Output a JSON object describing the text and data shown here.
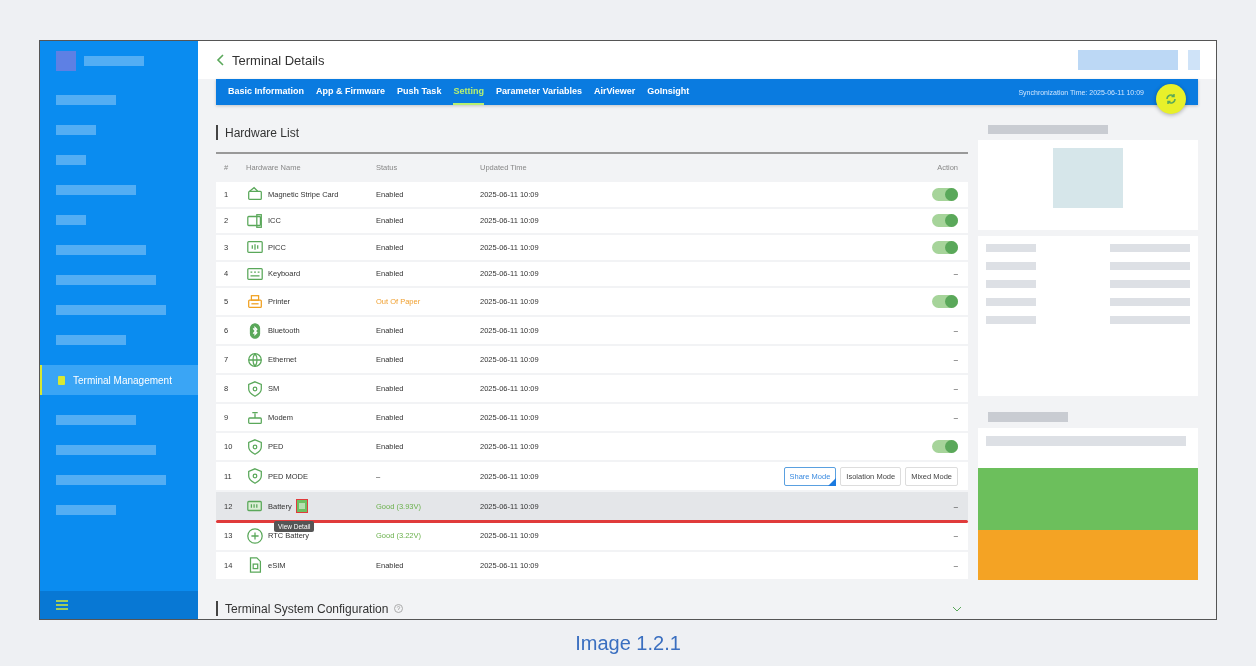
{
  "sidebar": {
    "items": [
      {
        "label": "Terminal Management",
        "selected": true
      }
    ]
  },
  "header": {
    "title": "Terminal Details"
  },
  "tabs": [
    {
      "label": "Basic Information",
      "selected": false
    },
    {
      "label": "App & Firmware",
      "selected": false
    },
    {
      "label": "Push Task",
      "selected": false
    },
    {
      "label": "Setting",
      "selected": true
    },
    {
      "label": "Parameter Variables",
      "selected": false
    },
    {
      "label": "AirViewer",
      "selected": false
    },
    {
      "label": "GoInsight",
      "selected": false
    }
  ],
  "sync_time": "Synchronization Time: 2025-06-11 10:09",
  "hardware_list": {
    "title": "Hardware List",
    "columns": [
      "#",
      "Hardware Name",
      "Status",
      "Updated Time",
      "Action"
    ],
    "rows": [
      {
        "index": "1",
        "kind": "card",
        "name": "Magnetic Stripe Card",
        "status": {
          "text": "Enabled",
          "kind": "normal"
        },
        "time": "2025-06-11 10:09",
        "highlighted": false,
        "action": {
          "kind": "toggle",
          "on": true
        }
      },
      {
        "index": "2",
        "kind": "chip",
        "name": "ICC",
        "status": {
          "text": "Enabled",
          "kind": "normal"
        },
        "time": "2025-06-11 10:09",
        "highlighted": false,
        "action": {
          "kind": "toggle",
          "on": true
        }
      },
      {
        "index": "3",
        "kind": "contactless",
        "name": "PICC",
        "status": {
          "text": "Enabled",
          "kind": "normal"
        },
        "time": "2025-06-11 10:09",
        "highlighted": false,
        "action": {
          "kind": "toggle",
          "on": true
        }
      },
      {
        "index": "4",
        "kind": "keyboard",
        "name": "Keyboard",
        "status": {
          "text": "Enabled",
          "kind": "normal"
        },
        "time": "2025-06-11 10:09",
        "highlighted": false,
        "action": {
          "kind": "text",
          "text": "–"
        }
      },
      {
        "index": "5",
        "kind": "printer",
        "name": "Printer",
        "status": {
          "text": "Out Of Paper",
          "kind": "warning"
        },
        "time": "2025-06-11 10:09",
        "highlighted": false,
        "action": {
          "kind": "toggle",
          "on": true
        }
      },
      {
        "index": "6",
        "kind": "bluetooth",
        "name": "Bluetooth",
        "status": {
          "text": "Enabled",
          "kind": "normal"
        },
        "time": "2025-06-11 10:09",
        "highlighted": false,
        "action": {
          "kind": "text",
          "text": "–"
        }
      },
      {
        "index": "7",
        "kind": "globe",
        "name": "Ethernet",
        "status": {
          "text": "Enabled",
          "kind": "normal"
        },
        "time": "2025-06-11 10:09",
        "highlighted": false,
        "action": {
          "kind": "text",
          "text": "–"
        }
      },
      {
        "index": "8",
        "kind": "shield",
        "name": "SM",
        "status": {
          "text": "Enabled",
          "kind": "normal"
        },
        "time": "2025-06-11 10:09",
        "highlighted": false,
        "action": {
          "kind": "text",
          "text": "–"
        }
      },
      {
        "index": "9",
        "kind": "modem",
        "name": "Modem",
        "status": {
          "text": "Enabled",
          "kind": "normal"
        },
        "time": "2025-06-11 10:09",
        "highlighted": false,
        "action": {
          "kind": "text",
          "text": "–"
        }
      },
      {
        "index": "10",
        "kind": "shield",
        "name": "PED",
        "status": {
          "text": "Enabled",
          "kind": "normal"
        },
        "time": "2025-06-11 10:09",
        "highlighted": false,
        "action": {
          "kind": "toggle",
          "on": true
        }
      },
      {
        "index": "11",
        "kind": "shield",
        "name": "PED MODE",
        "status": {
          "text": "–",
          "kind": "normal"
        },
        "time": "2025-06-11 10:09",
        "highlighted": false,
        "action": {
          "kind": "modes",
          "options": [
            {
              "label": "Share Mode",
              "selected": true
            },
            {
              "label": "Isolation Mode",
              "selected": false
            },
            {
              "label": "Mixed Mode",
              "selected": false
            }
          ]
        }
      },
      {
        "index": "12",
        "kind": "battery",
        "name": "Battery",
        "status": {
          "text": "Good (3.93V)",
          "kind": "good"
        },
        "time": "2025-06-11 10:09",
        "highlighted": true,
        "tooltip": "View Detail",
        "action": {
          "kind": "text",
          "text": "–"
        }
      },
      {
        "index": "13",
        "kind": "plus",
        "name": "RTC Battery",
        "status": {
          "text": "Good (3.22V)",
          "kind": "good"
        },
        "time": "2025-06-11 10:09",
        "highlighted": false,
        "action": {
          "kind": "text",
          "text": "–"
        }
      },
      {
        "index": "14",
        "kind": "sim",
        "name": "eSIM",
        "status": {
          "text": "Enabled",
          "kind": "normal"
        },
        "time": "2025-06-11 10:09",
        "highlighted": false,
        "action": {
          "kind": "text",
          "text": "–"
        }
      }
    ]
  },
  "system_configuration": {
    "title": "Terminal System Configuration",
    "expanded": false
  },
  "caption": "Image 1.2.1"
}
